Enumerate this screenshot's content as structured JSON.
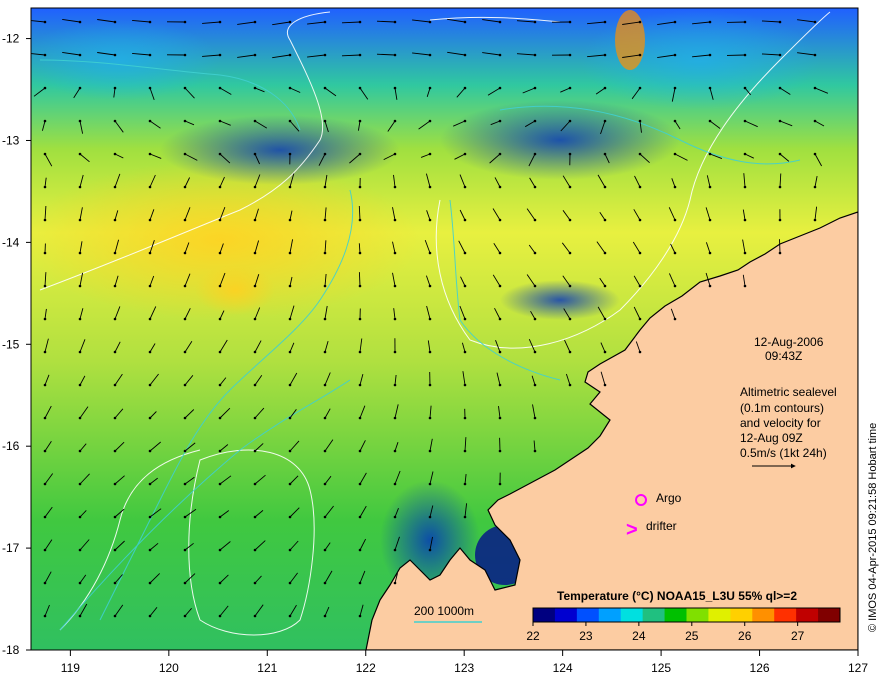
{
  "map": {
    "x_ticks": [
      "119",
      "120",
      "121",
      "122",
      "123",
      "124",
      "125",
      "126",
      "127"
    ],
    "y_ticks": [
      "-12",
      "-13",
      "-14",
      "-15",
      "-16",
      "-17",
      "-18"
    ],
    "lon_range": [
      118.6,
      127
    ],
    "lat_range": [
      -18,
      -11.7
    ]
  },
  "info": {
    "date": "12-Aug-2006",
    "time": "09:43Z",
    "alt_line1": "Altimetric sealevel",
    "alt_line2": "(0.1m contours)",
    "alt_line3": "and velocity for",
    "alt_line4": "12-Aug 09Z",
    "alt_line5": "0.5m/s (1kt 24h)"
  },
  "markers": {
    "argo_label": "Argo",
    "drifter_label": "drifter",
    "drifter_symbol": ">"
  },
  "bathy_legend": {
    "label": "200  1000m"
  },
  "colorbar": {
    "title": "Temperature (°C) NOAA15_L3U 55% ql>=2",
    "ticks": [
      "22",
      "23",
      "24",
      "25",
      "26",
      "27"
    ],
    "range": [
      22,
      27.8
    ],
    "colors": [
      "#000080",
      "#0000d0",
      "#0050ff",
      "#00a0ff",
      "#00e0e0",
      "#20c080",
      "#00c000",
      "#80e000",
      "#e0f000",
      "#ffd000",
      "#ff9000",
      "#ff3000",
      "#c00000",
      "#800000"
    ]
  },
  "credit": "© IMOS 04-Apr-2015 09:21:58 Hobart time",
  "colors": {
    "land": "#fccca2",
    "argo": "#ff00ff",
    "drifter": "#ff00ff",
    "contour": "#ffffff",
    "bathy": "#40d0d0"
  }
}
